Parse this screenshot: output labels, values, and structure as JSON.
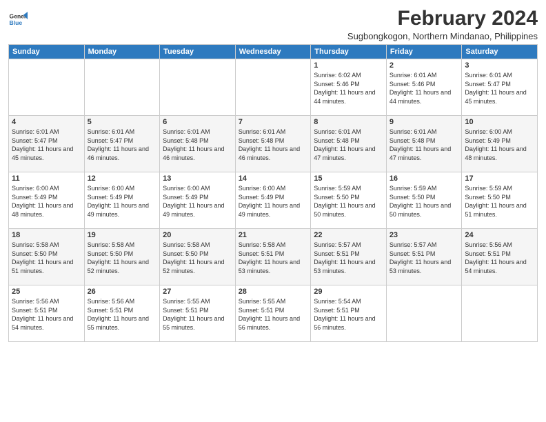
{
  "logo": {
    "line1": "General",
    "line2": "Blue"
  },
  "title": "February 2024",
  "location": "Sugbongkogon, Northern Mindanao, Philippines",
  "headers": [
    "Sunday",
    "Monday",
    "Tuesday",
    "Wednesday",
    "Thursday",
    "Friday",
    "Saturday"
  ],
  "weeks": [
    [
      {
        "day": "",
        "sunrise": "",
        "sunset": "",
        "daylight": ""
      },
      {
        "day": "",
        "sunrise": "",
        "sunset": "",
        "daylight": ""
      },
      {
        "day": "",
        "sunrise": "",
        "sunset": "",
        "daylight": ""
      },
      {
        "day": "",
        "sunrise": "",
        "sunset": "",
        "daylight": ""
      },
      {
        "day": "1",
        "sunrise": "Sunrise: 6:02 AM",
        "sunset": "Sunset: 5:46 PM",
        "daylight": "Daylight: 11 hours and 44 minutes."
      },
      {
        "day": "2",
        "sunrise": "Sunrise: 6:01 AM",
        "sunset": "Sunset: 5:46 PM",
        "daylight": "Daylight: 11 hours and 44 minutes."
      },
      {
        "day": "3",
        "sunrise": "Sunrise: 6:01 AM",
        "sunset": "Sunset: 5:47 PM",
        "daylight": "Daylight: 11 hours and 45 minutes."
      }
    ],
    [
      {
        "day": "4",
        "sunrise": "Sunrise: 6:01 AM",
        "sunset": "Sunset: 5:47 PM",
        "daylight": "Daylight: 11 hours and 45 minutes."
      },
      {
        "day": "5",
        "sunrise": "Sunrise: 6:01 AM",
        "sunset": "Sunset: 5:47 PM",
        "daylight": "Daylight: 11 hours and 46 minutes."
      },
      {
        "day": "6",
        "sunrise": "Sunrise: 6:01 AM",
        "sunset": "Sunset: 5:48 PM",
        "daylight": "Daylight: 11 hours and 46 minutes."
      },
      {
        "day": "7",
        "sunrise": "Sunrise: 6:01 AM",
        "sunset": "Sunset: 5:48 PM",
        "daylight": "Daylight: 11 hours and 46 minutes."
      },
      {
        "day": "8",
        "sunrise": "Sunrise: 6:01 AM",
        "sunset": "Sunset: 5:48 PM",
        "daylight": "Daylight: 11 hours and 47 minutes."
      },
      {
        "day": "9",
        "sunrise": "Sunrise: 6:01 AM",
        "sunset": "Sunset: 5:48 PM",
        "daylight": "Daylight: 11 hours and 47 minutes."
      },
      {
        "day": "10",
        "sunrise": "Sunrise: 6:00 AM",
        "sunset": "Sunset: 5:49 PM",
        "daylight": "Daylight: 11 hours and 48 minutes."
      }
    ],
    [
      {
        "day": "11",
        "sunrise": "Sunrise: 6:00 AM",
        "sunset": "Sunset: 5:49 PM",
        "daylight": "Daylight: 11 hours and 48 minutes."
      },
      {
        "day": "12",
        "sunrise": "Sunrise: 6:00 AM",
        "sunset": "Sunset: 5:49 PM",
        "daylight": "Daylight: 11 hours and 49 minutes."
      },
      {
        "day": "13",
        "sunrise": "Sunrise: 6:00 AM",
        "sunset": "Sunset: 5:49 PM",
        "daylight": "Daylight: 11 hours and 49 minutes."
      },
      {
        "day": "14",
        "sunrise": "Sunrise: 6:00 AM",
        "sunset": "Sunset: 5:49 PM",
        "daylight": "Daylight: 11 hours and 49 minutes."
      },
      {
        "day": "15",
        "sunrise": "Sunrise: 5:59 AM",
        "sunset": "Sunset: 5:50 PM",
        "daylight": "Daylight: 11 hours and 50 minutes."
      },
      {
        "day": "16",
        "sunrise": "Sunrise: 5:59 AM",
        "sunset": "Sunset: 5:50 PM",
        "daylight": "Daylight: 11 hours and 50 minutes."
      },
      {
        "day": "17",
        "sunrise": "Sunrise: 5:59 AM",
        "sunset": "Sunset: 5:50 PM",
        "daylight": "Daylight: 11 hours and 51 minutes."
      }
    ],
    [
      {
        "day": "18",
        "sunrise": "Sunrise: 5:58 AM",
        "sunset": "Sunset: 5:50 PM",
        "daylight": "Daylight: 11 hours and 51 minutes."
      },
      {
        "day": "19",
        "sunrise": "Sunrise: 5:58 AM",
        "sunset": "Sunset: 5:50 PM",
        "daylight": "Daylight: 11 hours and 52 minutes."
      },
      {
        "day": "20",
        "sunrise": "Sunrise: 5:58 AM",
        "sunset": "Sunset: 5:50 PM",
        "daylight": "Daylight: 11 hours and 52 minutes."
      },
      {
        "day": "21",
        "sunrise": "Sunrise: 5:58 AM",
        "sunset": "Sunset: 5:51 PM",
        "daylight": "Daylight: 11 hours and 53 minutes."
      },
      {
        "day": "22",
        "sunrise": "Sunrise: 5:57 AM",
        "sunset": "Sunset: 5:51 PM",
        "daylight": "Daylight: 11 hours and 53 minutes."
      },
      {
        "day": "23",
        "sunrise": "Sunrise: 5:57 AM",
        "sunset": "Sunset: 5:51 PM",
        "daylight": "Daylight: 11 hours and 53 minutes."
      },
      {
        "day": "24",
        "sunrise": "Sunrise: 5:56 AM",
        "sunset": "Sunset: 5:51 PM",
        "daylight": "Daylight: 11 hours and 54 minutes."
      }
    ],
    [
      {
        "day": "25",
        "sunrise": "Sunrise: 5:56 AM",
        "sunset": "Sunset: 5:51 PM",
        "daylight": "Daylight: 11 hours and 54 minutes."
      },
      {
        "day": "26",
        "sunrise": "Sunrise: 5:56 AM",
        "sunset": "Sunset: 5:51 PM",
        "daylight": "Daylight: 11 hours and 55 minutes."
      },
      {
        "day": "27",
        "sunrise": "Sunrise: 5:55 AM",
        "sunset": "Sunset: 5:51 PM",
        "daylight": "Daylight: 11 hours and 55 minutes."
      },
      {
        "day": "28",
        "sunrise": "Sunrise: 5:55 AM",
        "sunset": "Sunset: 5:51 PM",
        "daylight": "Daylight: 11 hours and 56 minutes."
      },
      {
        "day": "29",
        "sunrise": "Sunrise: 5:54 AM",
        "sunset": "Sunset: 5:51 PM",
        "daylight": "Daylight: 11 hours and 56 minutes."
      },
      {
        "day": "",
        "sunrise": "",
        "sunset": "",
        "daylight": ""
      },
      {
        "day": "",
        "sunrise": "",
        "sunset": "",
        "daylight": ""
      }
    ]
  ]
}
